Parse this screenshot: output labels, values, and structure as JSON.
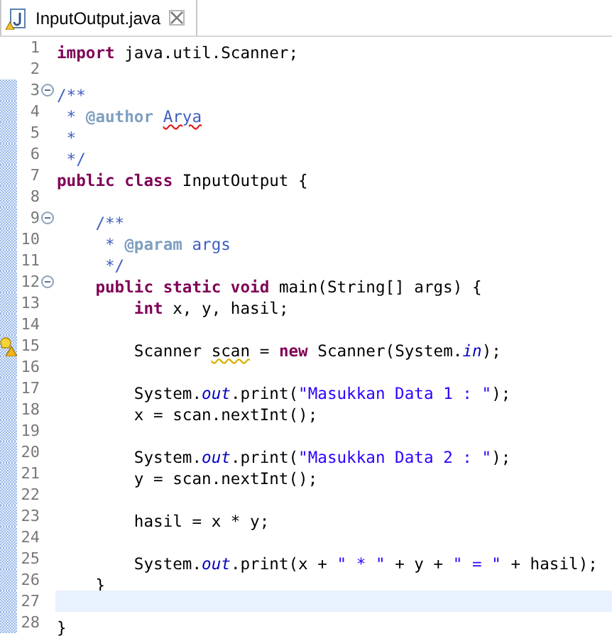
{
  "tabs": [
    {
      "title": "InputOutput.java",
      "selected": true,
      "warning": true
    }
  ],
  "lines": [
    {
      "number": "1",
      "changed": false,
      "fold": false,
      "warning": false,
      "current": false,
      "tokens": [
        {
          "kind": "keyword",
          "text": "import "
        },
        {
          "kind": "plain",
          "text": "java.util.Scanner;"
        }
      ]
    },
    {
      "number": "2",
      "changed": false,
      "fold": false,
      "warning": false,
      "current": false
    },
    {
      "number": "3",
      "changed": true,
      "fold": true,
      "warning": false,
      "current": false,
      "tokens": [
        {
          "kind": "doc",
          "text": "/**"
        }
      ]
    },
    {
      "number": "4",
      "changed": true,
      "fold": false,
      "warning": false,
      "current": false,
      "tokens": [
        {
          "kind": "doc",
          "text": " * "
        },
        {
          "kind": "tag",
          "text": "@author "
        },
        {
          "kind": "doc-misspelled",
          "text": "Arya"
        }
      ]
    },
    {
      "number": "5",
      "changed": true,
      "fold": false,
      "warning": false,
      "current": false,
      "tokens": [
        {
          "kind": "doc",
          "text": " *"
        }
      ]
    },
    {
      "number": "6",
      "changed": true,
      "fold": false,
      "warning": false,
      "current": false,
      "tokens": [
        {
          "kind": "doc",
          "text": " */"
        }
      ]
    },
    {
      "number": "7",
      "changed": true,
      "fold": false,
      "warning": false,
      "current": false,
      "tokens": [
        {
          "kind": "keyword",
          "text": "public class "
        },
        {
          "kind": "plain",
          "text": "InputOutput {"
        }
      ]
    },
    {
      "number": "8",
      "changed": true,
      "fold": false,
      "warning": false,
      "current": false
    },
    {
      "number": "9",
      "changed": true,
      "fold": true,
      "warning": false,
      "current": false,
      "tokens": [
        {
          "kind": "doc",
          "text": "    /**"
        }
      ]
    },
    {
      "number": "10",
      "changed": true,
      "fold": false,
      "warning": false,
      "current": false,
      "tokens": [
        {
          "kind": "doc",
          "text": "     * "
        },
        {
          "kind": "tag",
          "text": "@param"
        },
        {
          "kind": "doc",
          "text": " args"
        }
      ]
    },
    {
      "number": "11",
      "changed": true,
      "fold": false,
      "warning": false,
      "current": false,
      "tokens": [
        {
          "kind": "doc",
          "text": "     */"
        }
      ]
    },
    {
      "number": "12",
      "changed": true,
      "fold": true,
      "warning": false,
      "current": false,
      "tokens": [
        {
          "kind": "keyword",
          "text": "    public static void "
        },
        {
          "kind": "plain",
          "text": "main(String[] args) {"
        }
      ]
    },
    {
      "number": "13",
      "changed": true,
      "fold": false,
      "warning": false,
      "current": false,
      "tokens": [
        {
          "kind": "keyword",
          "text": "        int "
        },
        {
          "kind": "plain",
          "text": "x, y, hasil;"
        }
      ]
    },
    {
      "number": "14",
      "changed": true,
      "fold": false,
      "warning": false,
      "current": false
    },
    {
      "number": "15",
      "changed": true,
      "fold": false,
      "warning": true,
      "current": false,
      "tokens": [
        {
          "kind": "plain",
          "text": "        Scanner "
        },
        {
          "kind": "plain-unused",
          "text": "scan"
        },
        {
          "kind": "plain",
          "text": " = "
        },
        {
          "kind": "keyword",
          "text": "new "
        },
        {
          "kind": "plain",
          "text": "Scanner(System."
        },
        {
          "kind": "field",
          "text": "in"
        },
        {
          "kind": "plain",
          "text": ");"
        }
      ]
    },
    {
      "number": "16",
      "changed": true,
      "fold": false,
      "warning": false,
      "current": false
    },
    {
      "number": "17",
      "changed": true,
      "fold": false,
      "warning": false,
      "current": false,
      "tokens": [
        {
          "kind": "plain",
          "text": "        System."
        },
        {
          "kind": "field",
          "text": "out"
        },
        {
          "kind": "plain",
          "text": ".print("
        },
        {
          "kind": "string",
          "text": "\"Masukkan Data 1 : \""
        },
        {
          "kind": "plain",
          "text": ");"
        }
      ]
    },
    {
      "number": "18",
      "changed": true,
      "fold": false,
      "warning": false,
      "current": false,
      "tokens": [
        {
          "kind": "plain",
          "text": "        x = scan.nextInt();"
        }
      ]
    },
    {
      "number": "19",
      "changed": true,
      "fold": false,
      "warning": false,
      "current": false
    },
    {
      "number": "20",
      "changed": true,
      "fold": false,
      "warning": false,
      "current": false,
      "tokens": [
        {
          "kind": "plain",
          "text": "        System."
        },
        {
          "kind": "field",
          "text": "out"
        },
        {
          "kind": "plain",
          "text": ".print("
        },
        {
          "kind": "string",
          "text": "\"Masukkan Data 2 : \""
        },
        {
          "kind": "plain",
          "text": ");"
        }
      ]
    },
    {
      "number": "21",
      "changed": true,
      "fold": false,
      "warning": false,
      "current": false,
      "tokens": [
        {
          "kind": "plain",
          "text": "        y = scan.nextInt();"
        }
      ]
    },
    {
      "number": "22",
      "changed": true,
      "fold": false,
      "warning": false,
      "current": false
    },
    {
      "number": "23",
      "changed": true,
      "fold": false,
      "warning": false,
      "current": false,
      "tokens": [
        {
          "kind": "plain",
          "text": "        hasil = x * y;"
        }
      ]
    },
    {
      "number": "24",
      "changed": true,
      "fold": false,
      "warning": false,
      "current": false
    },
    {
      "number": "25",
      "changed": true,
      "fold": false,
      "warning": false,
      "current": false,
      "tokens": [
        {
          "kind": "plain",
          "text": "        System."
        },
        {
          "kind": "field",
          "text": "out"
        },
        {
          "kind": "plain",
          "text": ".print(x + "
        },
        {
          "kind": "string",
          "text": "\" * \""
        },
        {
          "kind": "plain",
          "text": " + y + "
        },
        {
          "kind": "string",
          "text": "\" = \""
        },
        {
          "kind": "plain",
          "text": " + hasil);"
        }
      ]
    },
    {
      "number": "26",
      "changed": true,
      "fold": false,
      "warning": false,
      "current": false,
      "tokens": [
        {
          "kind": "plain",
          "text": "    }"
        }
      ]
    },
    {
      "number": "27",
      "changed": true,
      "fold": false,
      "warning": false,
      "current": true
    },
    {
      "number": "28",
      "changed": true,
      "fold": false,
      "warning": false,
      "current": false,
      "tokens": [
        {
          "kind": "plain",
          "text": "}"
        }
      ]
    }
  ]
}
